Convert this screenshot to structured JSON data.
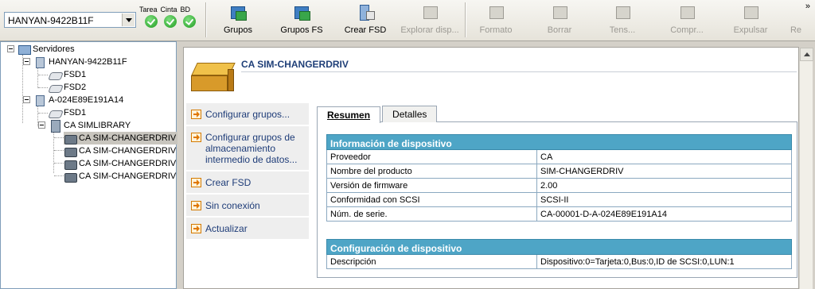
{
  "toolbar": {
    "server_selected": "HANYAN-9422B11F",
    "status_labels": [
      "Tarea",
      "Cinta",
      "BD"
    ],
    "buttons": [
      {
        "label": "Grupos",
        "enabled": true,
        "icon": "groups-icon"
      },
      {
        "label": "Grupos FS",
        "enabled": true,
        "icon": "groups-fs-icon"
      },
      {
        "label": "Crear FSD",
        "enabled": true,
        "icon": "create-fsd-icon"
      },
      {
        "label": "Explorar disp...",
        "enabled": false,
        "icon": "explore-device-icon"
      },
      {
        "label": "Formato",
        "enabled": false,
        "icon": "format-icon"
      },
      {
        "label": "Borrar",
        "enabled": false,
        "icon": "erase-icon"
      },
      {
        "label": "Tens...",
        "enabled": false,
        "icon": "tension-icon"
      },
      {
        "label": "Compr...",
        "enabled": false,
        "icon": "compress-icon"
      },
      {
        "label": "Expulsar",
        "enabled": false,
        "icon": "eject-icon"
      },
      {
        "label": "Re",
        "enabled": false,
        "icon": "more-icon"
      }
    ],
    "overflow_glyph": "»"
  },
  "tree": {
    "root": "Servidores",
    "server1": "HANYAN-9422B11F",
    "fsd1": "FSD1",
    "fsd2": "FSD2",
    "server2": "A-024E89E191A14",
    "server2_fsd1": "FSD1",
    "library": "CA SIMLIBRARY",
    "drives": [
      "CA SIM-CHANGERDRIV",
      "CA SIM-CHANGERDRIV",
      "CA SIM-CHANGERDRIV",
      "CA SIM-CHANGERDRIV"
    ]
  },
  "device": {
    "title": "CA SIM-CHANGERDRIV"
  },
  "actions": [
    "Configurar grupos...",
    "Configurar grupos de almacenamiento intermedio de datos...",
    "Crear FSD",
    "Sin conexión",
    "Actualizar"
  ],
  "tabs": [
    "Resumen",
    "Detalles"
  ],
  "info": {
    "title": "Información de dispositivo",
    "rows": [
      {
        "k": "Proveedor",
        "v": "CA"
      },
      {
        "k": "Nombre del producto",
        "v": "SIM-CHANGERDRIV"
      },
      {
        "k": "Versión de firmware",
        "v": "2.00"
      },
      {
        "k": "Conformidad con SCSI",
        "v": "SCSI-II"
      },
      {
        "k": "Núm. de serie.",
        "v": "CA-00001-D-A-024E89E191A14"
      }
    ]
  },
  "config": {
    "title": "Configuración de dispositivo",
    "rows": [
      {
        "k": "Descripción",
        "v": "Dispositivo:0=Tarjeta:0,Bus:0,ID de SCSI:0,LUN:1"
      }
    ]
  }
}
